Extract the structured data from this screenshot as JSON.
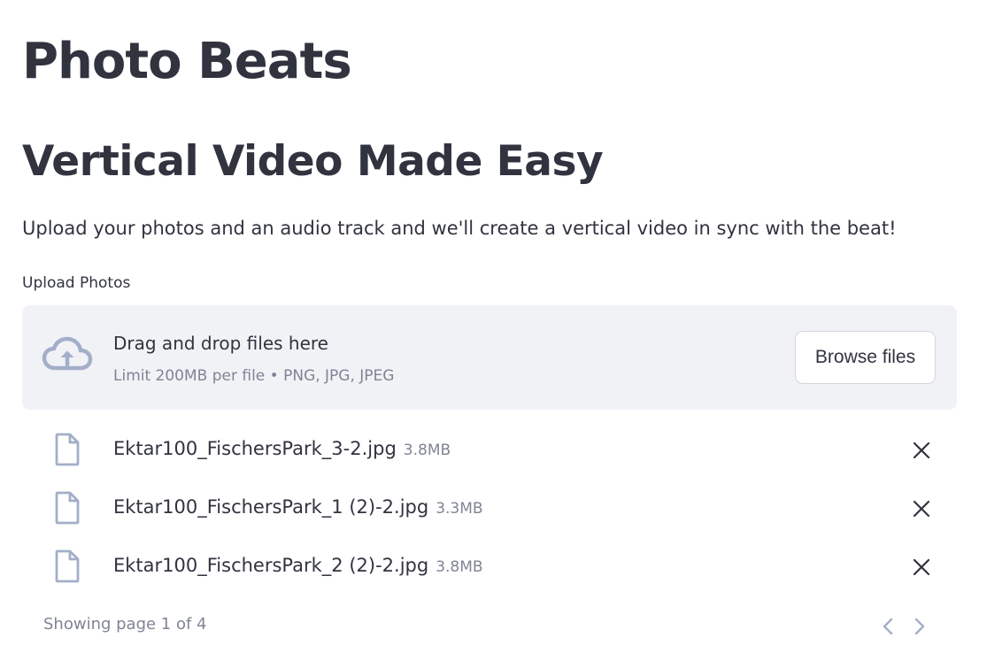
{
  "header": {
    "title": "Photo Beats",
    "subtitle": "Vertical Video Made Easy",
    "description": "Upload your photos and an audio track and we'll create a vertical video in sync with the beat!"
  },
  "uploader": {
    "label": "Upload Photos",
    "dropzone_title": "Drag and drop files here",
    "dropzone_limit": "Limit 200MB per file • PNG, JPG, JPEG",
    "browse_label": "Browse files",
    "icon": "cloud-upload-icon"
  },
  "files": [
    {
      "name": "Ektar100_FischersPark_3-2.jpg",
      "size": "3.8MB"
    },
    {
      "name": "Ektar100_FischersPark_1 (2)-2.jpg",
      "size": "3.3MB"
    },
    {
      "name": "Ektar100_FischersPark_2 (2)-2.jpg",
      "size": "3.8MB"
    }
  ],
  "pagination": {
    "text": "Showing page 1 of 4",
    "current_page": 1,
    "total_pages": 4
  },
  "colors": {
    "text": "#31333f",
    "muted": "#808495",
    "dropzone_bg": "#f0f2f6",
    "icon": "#a3aec9"
  }
}
